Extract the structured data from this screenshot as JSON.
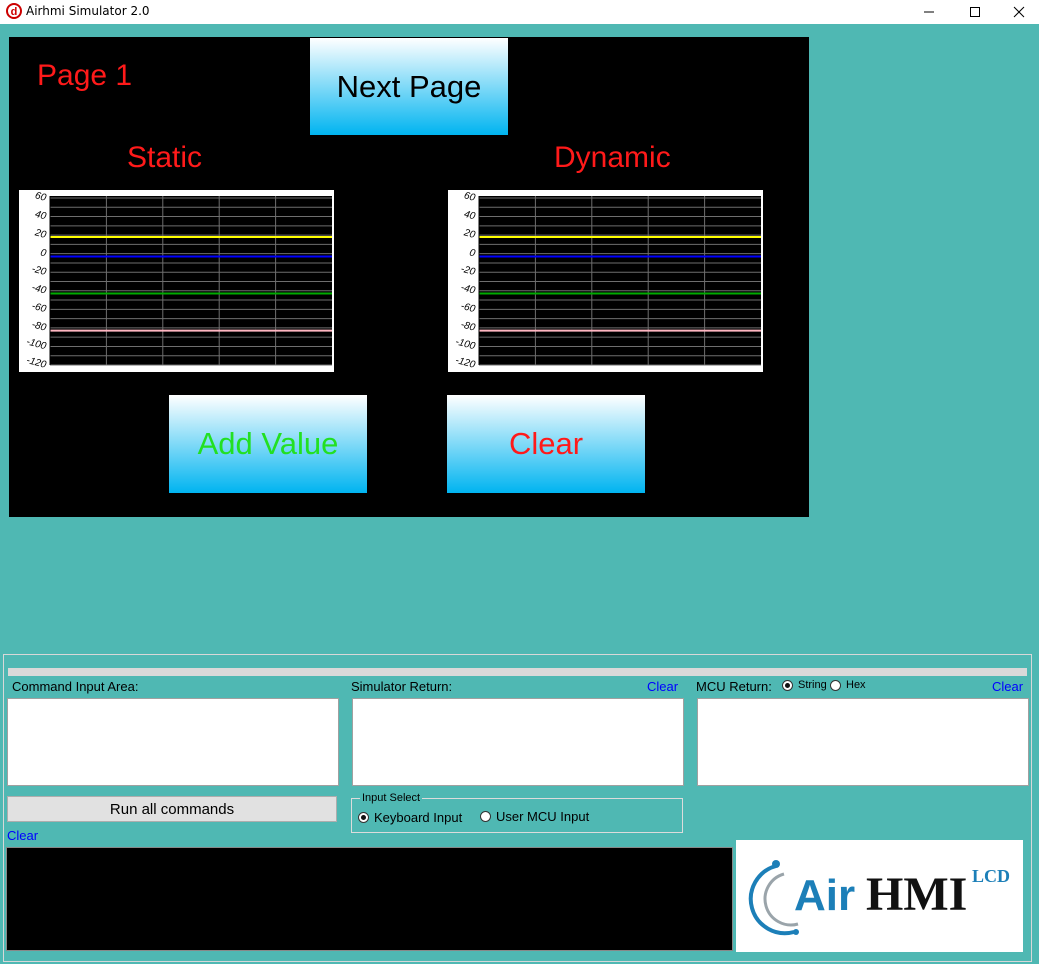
{
  "window": {
    "title": "Airhmi Simulator 2.0",
    "minimize_icon": "minimize-icon",
    "maximize_icon": "maximize-icon",
    "close_icon": "close-icon"
  },
  "hmi_screen": {
    "page_label": "Page 1",
    "next_page_label": "Next Page",
    "static_title": "Static",
    "dynamic_title": "Dynamic",
    "add_value_label": "Add Value",
    "clear_label": "Clear",
    "colors": {
      "background": "#000000",
      "page_label": "#ff1a1a",
      "add_value_text": "#22e022",
      "clear_text": "#ff1a1a",
      "button_gradient_top": "#ffffff",
      "button_gradient_bottom": "#00b4f0"
    }
  },
  "chart_data": [
    {
      "type": "line",
      "name": "Static",
      "ylim": [
        -120,
        60
      ],
      "yticks": [
        "60",
        "40",
        "20",
        "0",
        "-20",
        "-40",
        "-60",
        "-80",
        "-100",
        "-120"
      ],
      "x_divisions": 5,
      "series": [
        {
          "color": "#ffff00",
          "values": [
            18,
            18
          ]
        },
        {
          "color": "#0000ff",
          "values": [
            -3,
            -3
          ]
        },
        {
          "color": "#00aa00",
          "values": [
            -43,
            -43
          ]
        },
        {
          "color": "#ffb6c1",
          "values": [
            -83,
            -83
          ]
        }
      ]
    },
    {
      "type": "line",
      "name": "Dynamic",
      "ylim": [
        -120,
        60
      ],
      "yticks": [
        "60",
        "40",
        "20",
        "0",
        "-20",
        "-40",
        "-60",
        "-80",
        "-100",
        "-120"
      ],
      "x_divisions": 5,
      "series": [
        {
          "color": "#ffff00",
          "values": [
            18,
            18
          ]
        },
        {
          "color": "#0000ff",
          "values": [
            -3,
            -3
          ]
        },
        {
          "color": "#00aa00",
          "values": [
            -43,
            -43
          ]
        },
        {
          "color": "#ffb6c1",
          "values": [
            -83,
            -83
          ]
        }
      ]
    }
  ],
  "tools": {
    "command_input_label": "Command Input Area:",
    "simulator_return_label": "Simulator Return:",
    "simulator_clear": "Clear",
    "mcu_return_label": "MCU Return:",
    "mcu_format_options": [
      {
        "label": "String",
        "selected": true
      },
      {
        "label": "Hex",
        "selected": false
      }
    ],
    "mcu_clear": "Clear",
    "run_all_label": "Run all commands",
    "command_clear": "Clear",
    "input_select_legend": "Input Select",
    "input_options": [
      {
        "label": "Keyboard Input",
        "selected": true
      },
      {
        "label": "User MCU Input",
        "selected": false
      }
    ],
    "command_input_value": "",
    "simulator_return_value": "",
    "mcu_return_value": ""
  },
  "logo": {
    "text_air": "Air",
    "text_hmi": "HMI",
    "text_lcd": "LCD",
    "color_air": "#1c7fb8",
    "color_hmi": "#111111",
    "color_lcd": "#1c7fb8"
  }
}
